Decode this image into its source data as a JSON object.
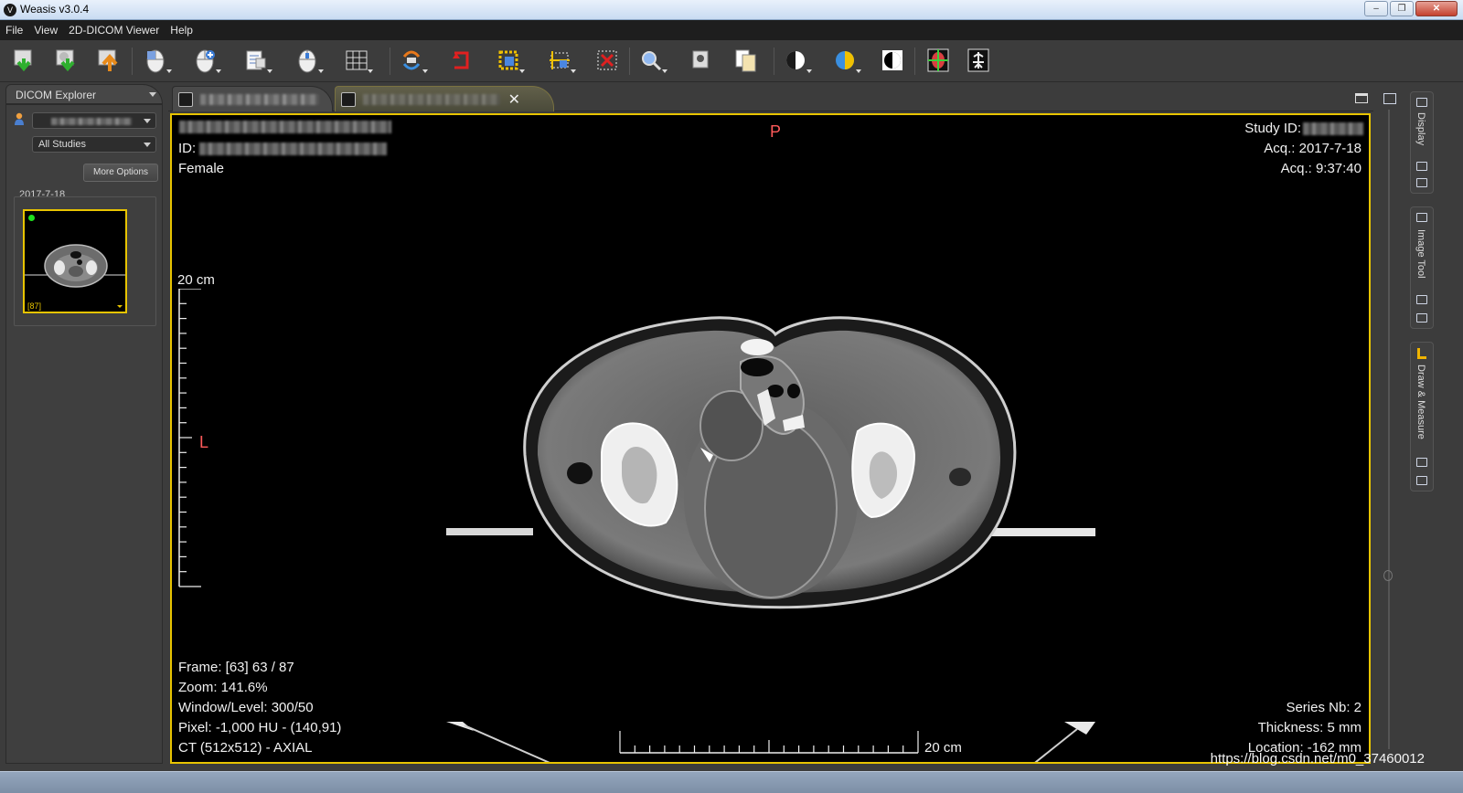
{
  "window": {
    "title": "Weasis v3.0.4",
    "app_icon_glyph": "V",
    "minimize": "–",
    "restore": "❐",
    "close": "✕"
  },
  "menu": [
    "File",
    "View",
    "2D-DICOM Viewer",
    "Help"
  ],
  "toolbar": {
    "tools": [
      {
        "name": "import-dicom-icon",
        "dropdown": false
      },
      {
        "name": "import-dicom-cd-icon",
        "dropdown": false
      },
      {
        "name": "export-dicom-icon",
        "dropdown": false
      },
      {
        "name": "mouse-left-action-icon",
        "dropdown": true
      },
      {
        "name": "mouse-middle-action-icon",
        "dropdown": true
      },
      {
        "name": "mouse-right-action-icon",
        "dropdown": true
      },
      {
        "name": "mouse-wheel-action-icon",
        "dropdown": true
      },
      {
        "name": "layout-grid-icon",
        "dropdown": true
      },
      {
        "name": "synchronize-icon",
        "dropdown": true
      },
      {
        "name": "reset-icon",
        "dropdown": false
      },
      {
        "name": "select-area-icon",
        "dropdown": true
      },
      {
        "name": "crosshair-select-icon",
        "dropdown": true
      },
      {
        "name": "delete-selection-icon",
        "dropdown": false
      },
      {
        "name": "zoom-icon",
        "dropdown": true
      },
      {
        "name": "lens-icon",
        "dropdown": false
      },
      {
        "name": "copy-image-icon",
        "dropdown": false
      },
      {
        "name": "window-level-icon",
        "dropdown": true
      },
      {
        "name": "lut-color-icon",
        "dropdown": true
      },
      {
        "name": "invert-lut-icon",
        "dropdown": false
      },
      {
        "name": "mpr-icon",
        "dropdown": false
      },
      {
        "name": "mip-icon",
        "dropdown": false
      }
    ]
  },
  "explorer": {
    "tab_label": "DICOM Explorer",
    "studies_filter": "All Studies",
    "more_options": "More Options",
    "study_date": "2017-7-18",
    "thumbnail_frames": "[87]"
  },
  "viewer": {
    "orientation_top": "P",
    "orientation_left": "L",
    "top_left": {
      "id_label": "ID:",
      "sex": "Female"
    },
    "top_right": {
      "study_id_label": "Study ID:",
      "acq_date": "Acq.: 2017-7-18",
      "acq_time": "Acq.: 9:37:40"
    },
    "bottom_left": {
      "frame": "Frame: [63] 63 / 87",
      "zoom": "Zoom: 141.6%",
      "window_level": "Window/Level: 300/50",
      "pixel": "Pixel: -1,000 HU - (140,91)",
      "modality": "CT (512x512) - AXIAL"
    },
    "bottom_right": {
      "series": "Series Nb: 2",
      "thickness": "Thickness: 5 mm",
      "location": "Location: -162 mm"
    },
    "vertical_scale_label": "20 cm",
    "horizontal_scale_label": "20 cm"
  },
  "right_dock": [
    "Display",
    "Image Tool",
    "Draw & Measure"
  ],
  "watermark": "https://blog.csdn.net/m0_37460012"
}
